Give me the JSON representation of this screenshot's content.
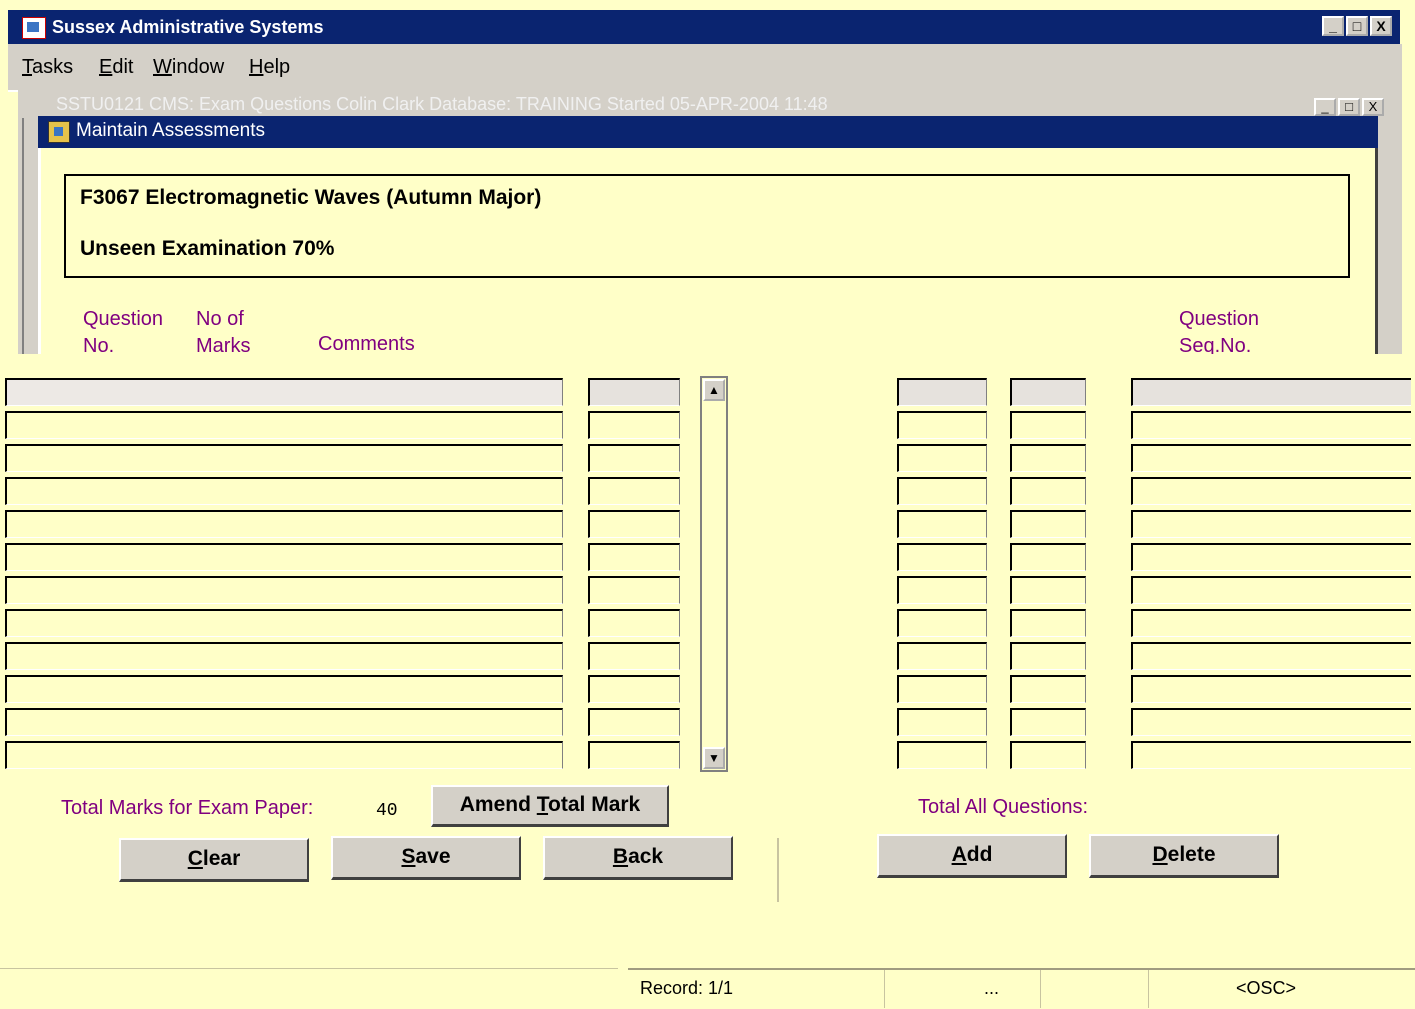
{
  "app": {
    "title": "Sussex Administrative Systems",
    "window_buttons": [
      "_",
      "□",
      "X"
    ]
  },
  "menu": {
    "items": [
      {
        "key": "T",
        "rest": "asks"
      },
      {
        "key": "E",
        "rest": "dit"
      },
      {
        "key": "W",
        "rest": "indow"
      },
      {
        "key": "H",
        "rest": "elp"
      }
    ]
  },
  "background_window": {
    "title": "SSTU0121  CMS: Exam Questions Colin Clark  Database: TRAINING  Started 05-APR-2004 11:48"
  },
  "dialog": {
    "title": "Maintain Assessments",
    "module": "F3067 Electromagnetic Waves (Autumn Major)",
    "assessment": "Unseen Examination 70%"
  },
  "columns": {
    "question_no": "Question No.",
    "no_of_marks": "No of Marks",
    "comments": "Comments",
    "question_seq_no": "Question Seq.No."
  },
  "grid": {
    "row_count": 12
  },
  "totals": {
    "exam_paper_label": "Total Marks for Exam Paper:",
    "exam_paper_value": "40",
    "all_questions_label": "Total All Questions:"
  },
  "buttons": {
    "amend_total_mark": {
      "pre": "Amend ",
      "key": "T",
      "post": "otal Mark"
    },
    "clear": {
      "pre": "",
      "key": "C",
      "post": "lear"
    },
    "save": {
      "pre": "",
      "key": "S",
      "post": "ave"
    },
    "back": {
      "pre": "",
      "key": "B",
      "post": "ack"
    },
    "add": {
      "pre": "",
      "key": "A",
      "post": "dd"
    },
    "delete": {
      "pre": "",
      "key": "D",
      "post": "elete"
    }
  },
  "status_bar": {
    "record": "Record: 1/1",
    "ellipsis": "...",
    "mode": "<OSC>"
  }
}
